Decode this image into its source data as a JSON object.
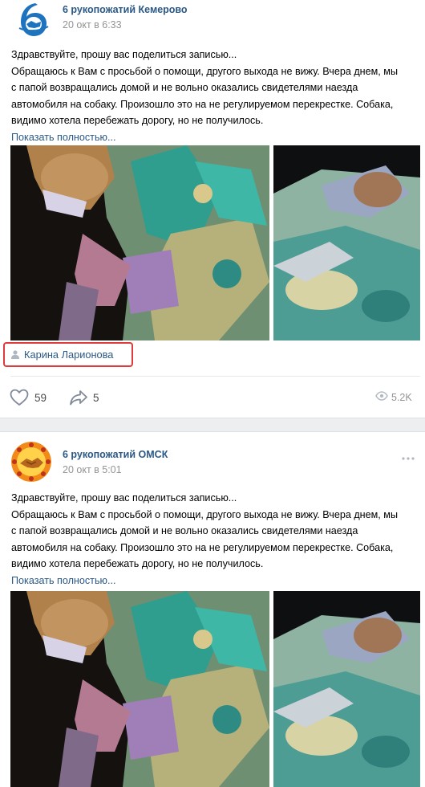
{
  "posts": [
    {
      "author": "6 рукопожатий Кемерово",
      "date": "20 окт в 6:33",
      "text_lines": [
        "Здравствуйте, прошу вас поделиться записью...",
        "Обращаюсь к Вам с просьбой о помощи, другого выхода не вижу. Вчера днем, мы",
        "с папой возвращались домой и не вольно оказались свидетелями наезда",
        "автомобиля на собаку. Произошло это на не регулируемом перекрестке. Собака,",
        "видимо хотела перебежать дорогу, но не получилось."
      ],
      "show_more": "Показать полностью...",
      "signer": "Карина Ларионова",
      "likes": "59",
      "shares": "5",
      "views": "5.2K"
    },
    {
      "author": "6 рукопожатий ОМСК",
      "date": "20 окт в 5:01",
      "text_lines": [
        "Здравствуйте, прошу вас поделиться записью...",
        "Обращаюсь к Вам с просьбой о помощи, другого выхода не вижу. Вчера днем, мы",
        "с папой возвращались домой и не вольно оказались свидетелями наезда",
        "автомобиля на собаку. Произошло это на не регулируемом перекрестке. Собака,",
        "видимо хотела перебежать дорогу, но не получилось."
      ],
      "show_more": "Показать полностью..."
    }
  ],
  "icons": {
    "avatar1": "handshake-logo-icon",
    "avatar2": "handshake-logo-icon",
    "signer": "user-icon",
    "like": "heart-icon",
    "share": "share-arrow-icon",
    "views": "eye-icon",
    "more": "more-dots-icon"
  },
  "colors": {
    "link": "#2a5885",
    "meta": "#939393",
    "highlight": "#e03a3a",
    "divider": "#edeef0"
  }
}
